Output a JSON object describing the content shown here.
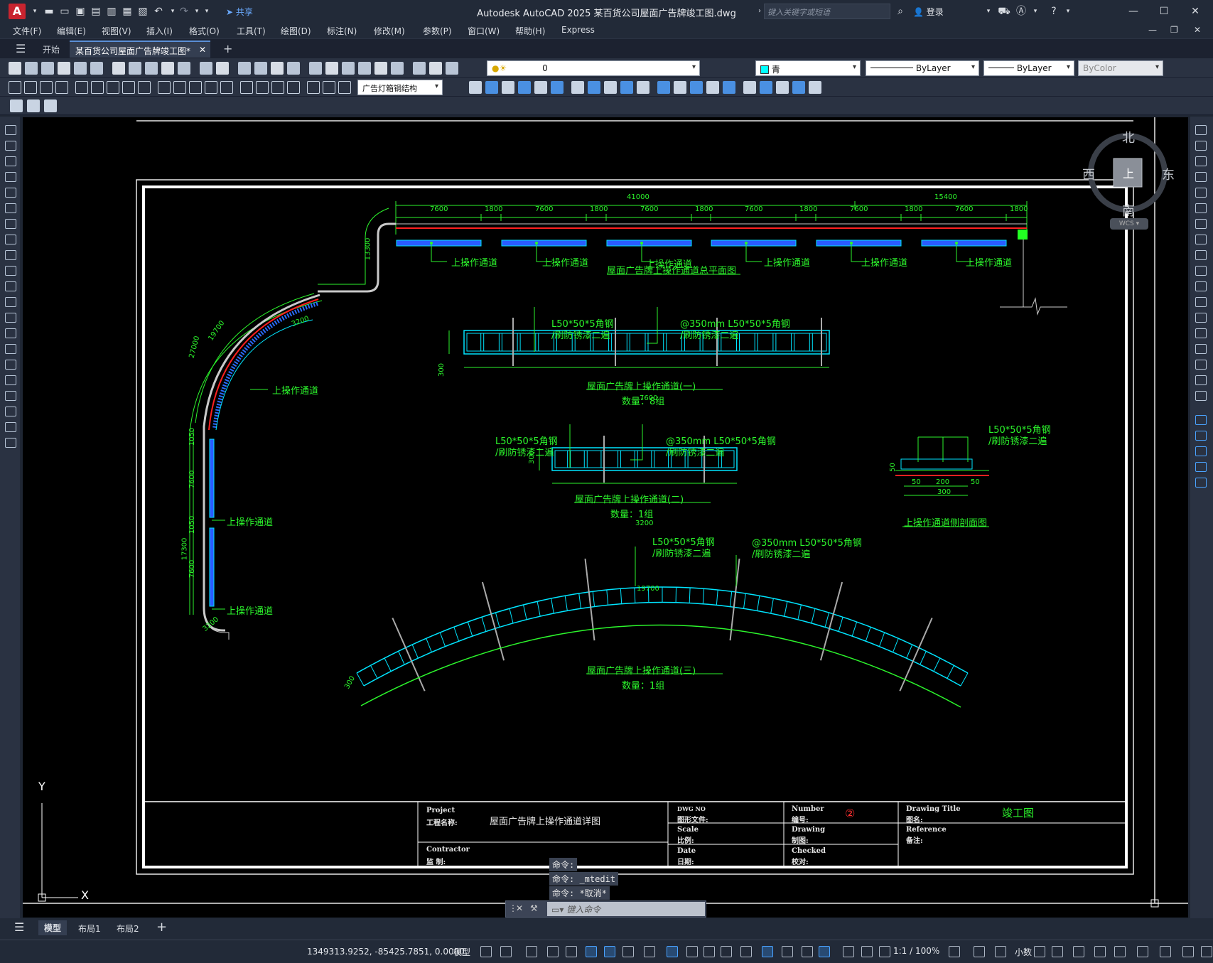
{
  "app": {
    "logo": "A",
    "title": "Autodesk AutoCAD 2025    某百货公司屋面广告牌竣工图.dwg",
    "share_label": "共享",
    "search_placeholder": "键入关键字或短语",
    "login_label": "登录"
  },
  "menu": [
    "文件(F)",
    "编辑(E)",
    "视图(V)",
    "插入(I)",
    "格式(O)",
    "工具(T)",
    "绘图(D)",
    "标注(N)",
    "修改(M)",
    "参数(P)",
    "窗口(W)",
    "帮助(H)",
    "Express"
  ],
  "tabs": {
    "start": "开始",
    "document": "某百货公司屋面广告牌竣工图*",
    "add": "+"
  },
  "toolbar": {
    "layer_value": "0",
    "color_value": "青",
    "linetype_value": "ByLayer",
    "lineweight_value": "ByLayer",
    "plotstyle_value": "ByColor",
    "dimstyle_value": "广告灯箱钢结构"
  },
  "compass": {
    "north": "北",
    "south": "南",
    "east": "东",
    "west": "西",
    "top": "上",
    "wcs": "WCS"
  },
  "drawing": {
    "plan_title": "屋面广告牌上操作通道总平面图",
    "passage_label": "上操作通道",
    "dims_top": {
      "total_41000": "41000",
      "total_15400": "15400",
      "seg_7600": "7600",
      "seg_1800": "1800"
    },
    "dim_13300": "13300",
    "dim_3200": "3200",
    "dim_19700": "19700",
    "dim_27000": "27000",
    "dim_1050": "1050",
    "dim_7600": "7600",
    "dim_17300": "17300",
    "dim_300": "300",
    "dim_50": "50",
    "dim_200": "200",
    "angle_steel": "L50*50*5角钢",
    "antirust": "/刷防锈漆二遍",
    "angle_steel_spacing": "@350mm L50*50*5角钢",
    "angle_steel_side": "L50*50*5角钢",
    "detail1_title": "屋面广告牌上操作通道(一)",
    "detail1_qty": "数量：8组",
    "detail2_title": "屋面广告牌上操作通道(二)",
    "detail2_qty": "数量：1组",
    "detail3_title": "屋面广告牌上操作通道(三)",
    "detail3_qty": "数量：1组",
    "section_title": "上操作通道侧剖面图"
  },
  "title_block": {
    "project_en": "Project",
    "project_cn": "工程名称:",
    "project_name": "屋面广告牌上操作通道详图",
    "contractor_en": "Contractor",
    "contractor_cn": "监 制:",
    "file_en": "DWG NO",
    "file_cn": "图形文件:",
    "scale_en": "Scale",
    "scale_cn": "比例:",
    "date_en": "Date",
    "date_cn": "日期:",
    "number_en": "Number",
    "number_cn": "编号:",
    "number_value": "②",
    "drawing_en": "Drawing",
    "drawing_cn": "制图:",
    "checked_en": "Checked",
    "checked_cn": "校对:",
    "title_en": "Drawing Title",
    "title_cn": "图名:",
    "title_value": "竣工图",
    "ref_en": "Reference",
    "ref_cn": "备注:"
  },
  "ucs": {
    "x": "X",
    "y": "Y"
  },
  "command": {
    "history": [
      "命令:",
      "命令: _mtedit",
      "命令: *取消*"
    ],
    "placeholder": "键入命令"
  },
  "layout_tabs": {
    "model": "模型",
    "layout1": "布局1",
    "layout2": "布局2",
    "add": "+"
  },
  "status": {
    "coordinates": "1349313.9252, -85425.7851, 0.0000",
    "model": "模型",
    "scale": "1:1 / 100%",
    "units": "小数"
  }
}
